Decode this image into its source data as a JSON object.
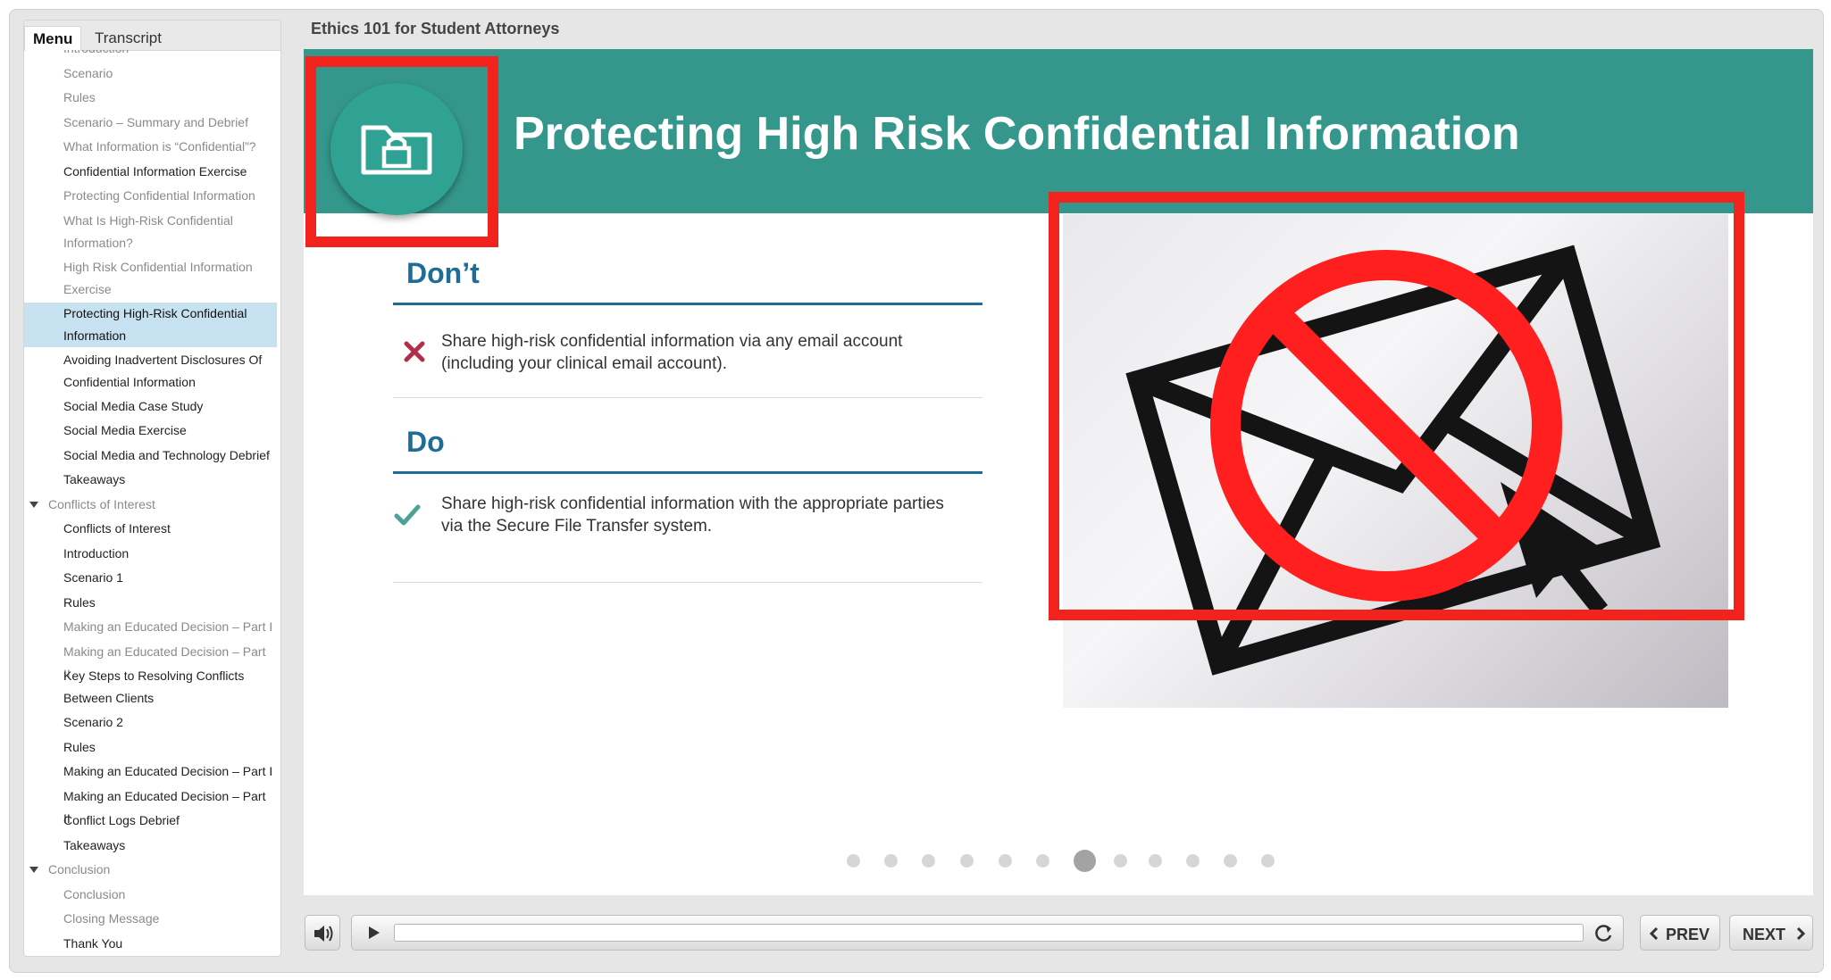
{
  "course_title": "Ethics 101 for Student Attorneys",
  "sidebar": {
    "tabs": [
      "Menu",
      "Transcript"
    ],
    "items": [
      {
        "label": "Introduction",
        "state": "dim"
      },
      {
        "label": "Scenario",
        "state": "dim"
      },
      {
        "label": "Rules",
        "state": "dim"
      },
      {
        "label": "Scenario – Summary and Debrief",
        "state": "dim"
      },
      {
        "label": "What Information is “Confidential”?",
        "state": "dim"
      },
      {
        "label": "Confidential Information Exercise",
        "state": "normal"
      },
      {
        "label": "Protecting Confidential Information",
        "state": "dim"
      },
      {
        "label": "What Is High-Risk Confidential",
        "label2": "Information?",
        "state": "dim"
      },
      {
        "label": "High Risk Confidential Information",
        "label2": "Exercise",
        "state": "dim"
      },
      {
        "label": "Protecting High-Risk Confidential",
        "label2": "Information",
        "state": "selected"
      },
      {
        "label": "Avoiding Inadvertent Disclosures Of",
        "label2": "Confidential Information",
        "state": "normal"
      },
      {
        "label": "Social Media Case Study",
        "state": "normal"
      },
      {
        "label": "Social Media Exercise",
        "state": "normal"
      },
      {
        "label": "Social Media and Technology Debrief",
        "state": "normal"
      },
      {
        "label": "Takeaways",
        "state": "normal"
      },
      {
        "label": "Conflicts of Interest",
        "state": "section"
      },
      {
        "label": "Conflicts of Interest",
        "state": "normal"
      },
      {
        "label": "Introduction",
        "state": "normal"
      },
      {
        "label": "Scenario 1",
        "state": "normal"
      },
      {
        "label": "Rules",
        "state": "normal"
      },
      {
        "label": "Making an Educated Decision – Part I",
        "state": "dim"
      },
      {
        "label": "Making an Educated Decision – Part II",
        "state": "dim"
      },
      {
        "label": "Key Steps to Resolving Conflicts",
        "label2": "Between Clients",
        "state": "normal"
      },
      {
        "label": "Scenario 2",
        "state": "normal"
      },
      {
        "label": "Rules",
        "state": "normal"
      },
      {
        "label": "Making an Educated Decision – Part I",
        "state": "normal"
      },
      {
        "label": "Making an Educated Decision – Part II",
        "state": "normal"
      },
      {
        "label": "Conflict Logs Debrief",
        "state": "normal"
      },
      {
        "label": "Takeaways",
        "state": "normal"
      },
      {
        "label": "Conclusion",
        "state": "section"
      },
      {
        "label": "Conclusion",
        "state": "dim"
      },
      {
        "label": "Closing Message",
        "state": "dim"
      },
      {
        "label": "Thank You",
        "state": "normal"
      }
    ]
  },
  "slide": {
    "title": "Protecting High Risk Confidential Information",
    "icon": "folder-lock-icon",
    "dont": {
      "heading": "Don’t",
      "icon": "x-icon",
      "text": "Share high-risk confidential information via any email account (including your clinical email account)."
    },
    "do": {
      "heading": "Do",
      "icon": "check-icon",
      "text": "Share high-risk confidential information with the appropriate parties via the Secure File Transfer system."
    },
    "image_subject": "no-email-icon",
    "page_dots": {
      "total": 12,
      "current": 7
    }
  },
  "player": {
    "prev_label": "PREV",
    "next_label": "NEXT"
  },
  "colors": {
    "banner": "#35978b",
    "heading_blue": "#1f6d97",
    "annotation_red": "#f2231d",
    "dont_x": "#b0304a",
    "do_check": "#4aa394",
    "selected_menu": "#c6e2f0"
  }
}
